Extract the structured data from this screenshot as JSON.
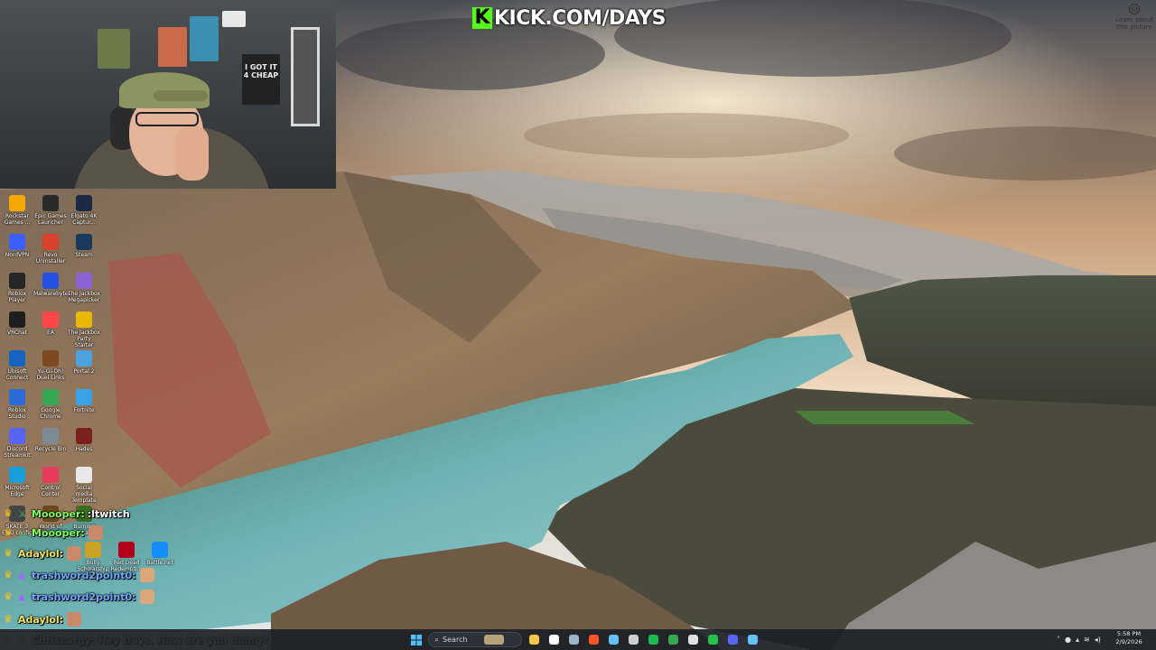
{
  "stream": {
    "watermark": "KICK.COM/DAYS",
    "learn_about": "Learn about this picture"
  },
  "webcam": {
    "shirt_text": "I GOT IT 4 CHEAP"
  },
  "desktop_icons": [
    {
      "label": "Rockstar Games ...",
      "icon": "rockstar-icon",
      "color": "#f5a800"
    },
    {
      "label": "Epic Games Launcher",
      "icon": "epic-games-icon",
      "color": "#2a2a2a"
    },
    {
      "label": "Elgato 4K Captur...",
      "icon": "elgato-icon",
      "color": "#1d2a44"
    },
    {
      "label": "NordVPN",
      "icon": "nordvpn-icon",
      "color": "#3e5fff"
    },
    {
      "label": "Revo Uninstaller",
      "icon": "revo-uninstaller-icon",
      "color": "#d9412a"
    },
    {
      "label": "Steam",
      "icon": "steam-icon",
      "color": "#1b3a5b"
    },
    {
      "label": "Roblox Player",
      "icon": "roblox-icon",
      "color": "#262626"
    },
    {
      "label": "Malwarebytes",
      "icon": "malwarebytes-icon",
      "color": "#2450e6"
    },
    {
      "label": "The Jackbox Megapicker",
      "icon": "jackbox-icon",
      "color": "#8a63d2"
    },
    {
      "label": "VRChat",
      "icon": "vrchat-icon",
      "color": "#1e1e1e"
    },
    {
      "label": "EA",
      "icon": "ea-icon",
      "color": "#ff4747"
    },
    {
      "label": "The Jackbox Party Starter",
      "icon": "jackbox-party-icon",
      "color": "#e6b800"
    },
    {
      "label": "Ubisoft Connect",
      "icon": "ubisoft-icon",
      "color": "#1565c0"
    },
    {
      "label": "Yu-Gi-Oh! Duel Links",
      "icon": "yugioh-icon",
      "color": "#7c4a1e"
    },
    {
      "label": "Portal 2",
      "icon": "portal-icon",
      "color": "#4aa3df"
    },
    {
      "label": "Roblox Studio",
      "icon": "roblox-studio-icon",
      "color": "#2b6bd6"
    },
    {
      "label": "Google Chrome",
      "icon": "chrome-icon",
      "color": "#34a853"
    },
    {
      "label": "Fortnite",
      "icon": "fortnite-icon",
      "color": "#3aa0e8"
    },
    {
      "label": "Discord Streamkit",
      "icon": "discord-icon",
      "color": "#5865f2"
    },
    {
      "label": "Recycle Bin",
      "icon": "recycle-bin-icon",
      "color": "#7c8a96"
    },
    {
      "label": "Hades",
      "icon": "hades-icon",
      "color": "#7b1f1f"
    },
    {
      "label": "Microsoft Edge",
      "icon": "edge-icon",
      "color": "#1a9fd8"
    },
    {
      "label": "Control Center",
      "icon": "control-center-icon",
      "color": "#e83a5a"
    },
    {
      "label": "Social media Template",
      "icon": "document-icon",
      "color": "#e8e8e8"
    },
    {
      "label": "SKATE 3 EMU config",
      "icon": "skate-icon",
      "color": "#444444"
    },
    {
      "label": "World of Warcraft",
      "icon": "wow-icon",
      "color": "#6a4a1c"
    },
    {
      "label": "Burning Crusade",
      "icon": "burning-crusade-icon",
      "color": "#3d6b20"
    },
    {
      "label": "Bully Scholarship",
      "icon": "bully-icon",
      "color": "#c9a227"
    },
    {
      "label": "Red Dead Redempti...",
      "icon": "red-dead-icon",
      "color": "#b3001b"
    },
    {
      "label": "Battle.net",
      "icon": "battlenet-icon",
      "color": "#148eff"
    }
  ],
  "chat": [
    {
      "user": "Moooper",
      "user_color": "#7fff5a",
      "badges": [
        "crown",
        "sword"
      ],
      "message": ":ltwitch",
      "emote": null
    },
    {
      "user": "Moooper",
      "user_color": "#7fff5a",
      "badges": [
        "crown",
        "sword"
      ],
      "message": "",
      "emote": "face-emote"
    },
    {
      "user": "Adaylol",
      "user_color": "#f0e35a",
      "badges": [
        "crown"
      ],
      "message": "",
      "emote": "face-emote"
    },
    {
      "user": "trashword2point0",
      "user_color": "#6fa8ff",
      "badges": [
        "crown",
        "kick"
      ],
      "message": "",
      "emote": "cat-emote"
    },
    {
      "user": "trashword2point0",
      "user_color": "#6fa8ff",
      "badges": [
        "crown",
        "kick"
      ],
      "message": "",
      "emote": "cat-emote"
    },
    {
      "user": "Adaylol",
      "user_color": "#f0e35a",
      "badges": [
        "crown"
      ],
      "message": "",
      "emote": "face-emote"
    },
    {
      "user": "Chriscargy",
      "user_color": "#ffffff",
      "badges": [
        "crown",
        "sword"
      ],
      "message": "Hey Days. How are you doing?",
      "emote": null
    }
  ],
  "taskbar": {
    "search_placeholder": "Search",
    "time": "5:58 PM",
    "date": "2/9/2026",
    "apps": [
      {
        "icon": "file-explorer-icon",
        "color": "#f3c64b"
      },
      {
        "icon": "terminal-icon",
        "color": "#ffffff"
      },
      {
        "icon": "settings-icon",
        "color": "#9fb3c8"
      },
      {
        "icon": "brave-icon",
        "color": "#fb542b"
      },
      {
        "icon": "steam-icon",
        "color": "#66c0f4"
      },
      {
        "icon": "obs-icon",
        "color": "#cfcfcf"
      },
      {
        "icon": "spotify-icon",
        "color": "#1db954"
      },
      {
        "icon": "chrome-icon",
        "color": "#34a853"
      },
      {
        "icon": "epic-games-icon",
        "color": "#e0e0e0"
      },
      {
        "icon": "xbox-icon",
        "color": "#27c24c"
      },
      {
        "icon": "discord-icon",
        "color": "#5865f2"
      },
      {
        "icon": "steam-window-icon",
        "color": "#66c0f4"
      }
    ]
  }
}
